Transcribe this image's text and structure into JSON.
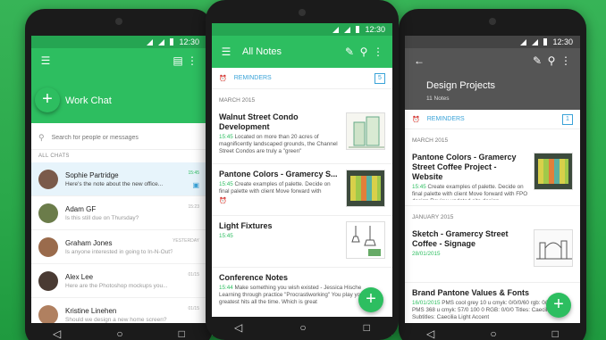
{
  "status_time": "12:30",
  "left_phone": {
    "title": "Work Chat",
    "search_placeholder": "Search for people or messages",
    "section": "ALL CHATS",
    "chats": [
      {
        "name": "Sophie Partridge",
        "msg": "Here's the note about the new office...",
        "time": "15:45",
        "active": true,
        "avatar_color": "#7a5a4a"
      },
      {
        "name": "Adam GF",
        "msg": "Is this still due on Thursday?",
        "time": "15:23",
        "active": false,
        "avatar_color": "#6b7c4a"
      },
      {
        "name": "Graham Jones",
        "msg": "Is anyone interested in going to In-N-Out?",
        "time": "YESTERDAY",
        "active": false,
        "avatar_color": "#9a6b4c"
      },
      {
        "name": "Alex Lee",
        "msg": "Here are the Photoshop mockups you...",
        "time": "01/15",
        "active": false,
        "avatar_color": "#4a3b33"
      },
      {
        "name": "Kristine Linehen",
        "msg": "Should we design a new home screen?",
        "time": "01/15",
        "active": false,
        "avatar_color": "#b08060"
      }
    ]
  },
  "center_phone": {
    "title": "All Notes",
    "reminders_label": "REMINDERS",
    "reminders_count": "5",
    "month": "MARCH 2015",
    "notes": [
      {
        "title": "Walnut Street Condo Development",
        "date": "15:45",
        "snippet": "Located on more than 20 acres of magnificently landscaped grounds, the Channel Street Condos are truly a \"green\"",
        "thumb": "building"
      },
      {
        "title": "Pantone Colors - Gramercy S...",
        "date": "15:45",
        "snippet": "Create examples of palette. Decide on final palette with client Move forward with",
        "thumb": "swatches"
      },
      {
        "title": "Light Fixtures",
        "date": "15:45",
        "snippet": "",
        "thumb": "sketch"
      },
      {
        "title": "Conference Notes",
        "date": "15:44",
        "snippet": "Make something you wish existed - Jessica Hische Learning through practice \"Procrastiworking\" You play your greatest hits all the time. Which is great",
        "thumb": ""
      }
    ]
  },
  "right_phone": {
    "title": "Design Projects",
    "subtitle": "11 Notes",
    "reminders_label": "REMINDERS",
    "reminders_count": "1",
    "months": [
      "MARCH 2015",
      "JANUARY 2015"
    ],
    "notes": [
      {
        "title": "Pantone Colors - Gramercy Street Coffee Project - Website",
        "date": "15:45",
        "snippet": "Create examples of palette. Decide on final palette with client Move forward with FPO design Review updated site design",
        "thumb": "swatches"
      },
      {
        "title": "Sketch - Gramercy Street Coffee - Signage",
        "date": "28/01/2015",
        "snippet": "",
        "thumb": "bridge"
      },
      {
        "title": "Brand Pantone Values & Fonts",
        "date": "16/01/2015",
        "snippet": "PMS cool grey 10 u  cmyk: 0/0/0/60  rgb: 0/0/0  PMS 368 u  cmyk: 57/0 100 0  RGB: 0/0/0  Titles: Caecilia Bold  Subtitles: Caecilia Light  Accent",
        "thumb": ""
      }
    ]
  },
  "colors": {
    "green": "#2dbe60",
    "blue": "#3aa3d8",
    "dark_header": "#555555"
  }
}
